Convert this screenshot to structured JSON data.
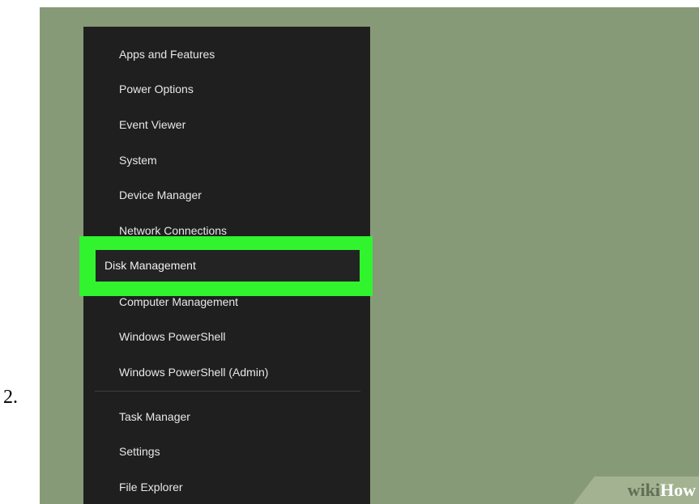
{
  "step_number": "2.",
  "menu": {
    "items_above": [
      "Apps and Features",
      "Power Options",
      "Event Viewer",
      "System",
      "Device Manager",
      "Network Connections"
    ],
    "highlighted_item": "Disk Management",
    "items_below": [
      "Computer Management",
      "Windows PowerShell",
      "Windows PowerShell (Admin)"
    ],
    "items_after_separator": [
      "Task Manager",
      "Settings",
      "File Explorer"
    ]
  },
  "watermark": {
    "part1": "wiki",
    "part2": "How"
  },
  "colors": {
    "background": "#879a78",
    "menu_background": "#1f1f1f",
    "highlight": "#31f42f"
  }
}
